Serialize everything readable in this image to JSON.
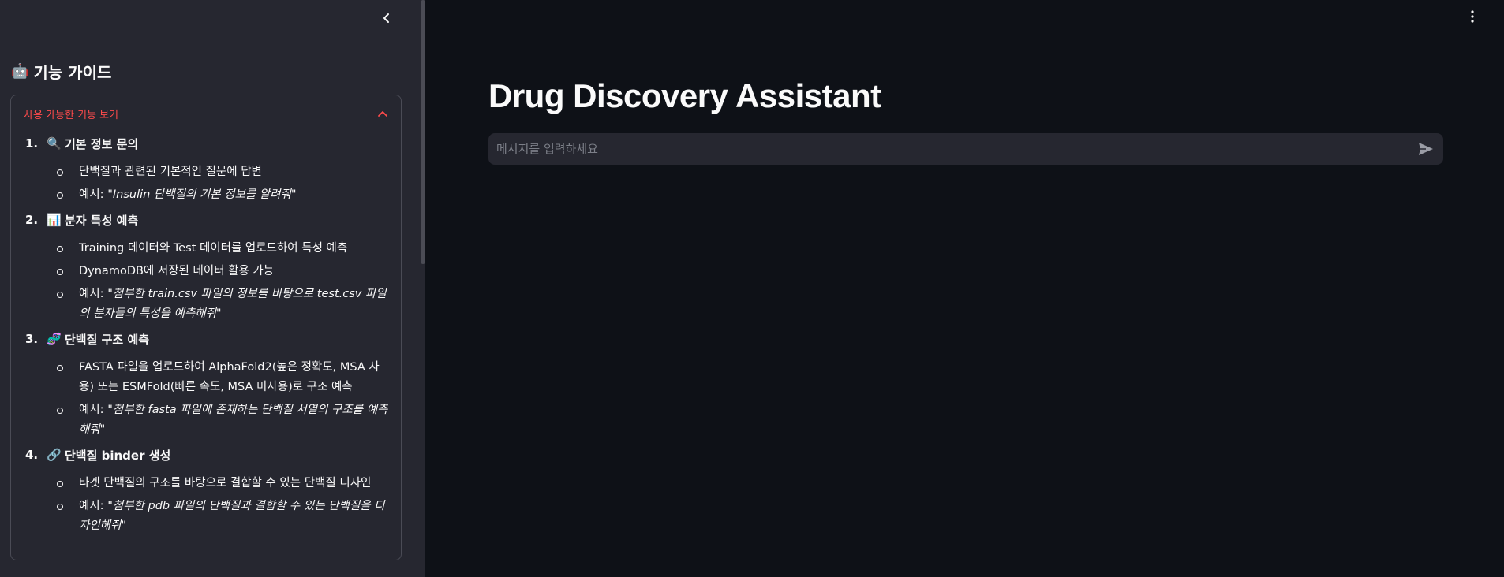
{
  "sidebar": {
    "heading_icon": "🤖",
    "heading": "기능 가이드",
    "expander": {
      "title": "사용 가능한 기능 보기",
      "features": [
        {
          "num": "1.",
          "emoji": "🔍",
          "title": "기본 정보 문의",
          "items": [
            {
              "prefix": "단백질과 관련된 기본적인 질문에 답변",
              "example": ""
            },
            {
              "prefix": "예시: ",
              "example": "\"Insulin 단백질의 기본 정보를 알려줘\""
            }
          ]
        },
        {
          "num": "2.",
          "emoji": "📊",
          "title": "분자 특성 예측",
          "items": [
            {
              "prefix": "Training 데이터와 Test 데이터를 업로드하여 특성 예측",
              "example": ""
            },
            {
              "prefix": "DynamoDB에 저장된 데이터 활용 가능",
              "example": ""
            },
            {
              "prefix": "예시: ",
              "example": "\"첨부한 train.csv 파일의 정보를 바탕으로 test.csv 파일의 분자들의 특성을 예측해줘\""
            }
          ]
        },
        {
          "num": "3.",
          "emoji": "🧬",
          "title": "단백질 구조 예측",
          "items": [
            {
              "prefix": "FASTA 파일을 업로드하여 AlphaFold2(높은 정확도, MSA 사용) 또는 ESMFold(빠른 속도, MSA 미사용)로 구조 예측",
              "example": ""
            },
            {
              "prefix": "예시: ",
              "example": "\"첨부한 fasta 파일에 존재하는 단백질 서열의 구조를 예측해줘\""
            }
          ]
        },
        {
          "num": "4.",
          "emoji": "🔗",
          "title": "단백질 binder 생성",
          "items": [
            {
              "prefix": "타겟 단백질의 구조를 바탕으로 결합할 수 있는 단백질 디자인",
              "example": ""
            },
            {
              "prefix": "예시: ",
              "example": "\"첨부한 pdb 파일의 단백질과 결합할 수 있는 단백질을 디자인해줘\""
            }
          ]
        }
      ]
    }
  },
  "main": {
    "title": "Drug Discovery Assistant",
    "chat_placeholder": "메시지를 입력하세요"
  },
  "colors": {
    "accent": "#ff4b4b",
    "sidebar_bg": "#262730",
    "main_bg": "#0e1117"
  },
  "icons": {
    "collapse": "chevron-left-icon",
    "expander": "chevron-up-icon",
    "menu": "kebab-menu-icon",
    "send": "send-icon"
  }
}
